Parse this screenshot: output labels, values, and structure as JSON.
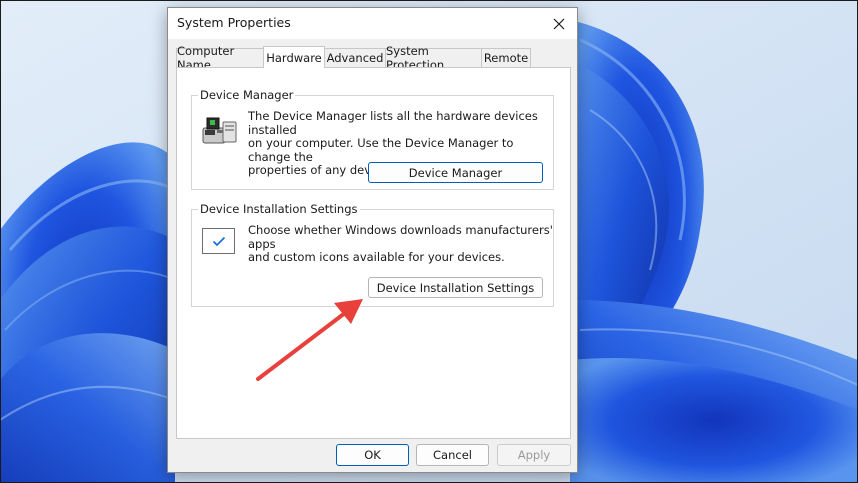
{
  "window": {
    "title": "System Properties"
  },
  "tabs": [
    {
      "label": "Computer Name"
    },
    {
      "label": "Hardware"
    },
    {
      "label": "Advanced"
    },
    {
      "label": "System Protection"
    },
    {
      "label": "Remote"
    }
  ],
  "device_manager": {
    "group_label": "Device Manager",
    "description_line1": "The Device Manager lists all the hardware devices installed",
    "description_line2": "on your computer. Use the Device Manager to change the",
    "description_line3": "properties of any device.",
    "button_label": "Device Manager",
    "icon": "device-manager-icon"
  },
  "device_installation": {
    "group_label": "Device Installation Settings",
    "description_line1": "Choose whether Windows downloads manufacturers' apps",
    "description_line2": "and custom icons available for your devices.",
    "button_label": "Device Installation Settings",
    "icon": "checkbox-check-icon"
  },
  "footer": {
    "ok_label": "OK",
    "cancel_label": "Cancel",
    "apply_label": "Apply"
  },
  "annotation": {
    "arrow_color": "#e8403a"
  },
  "colors": {
    "accent": "#005fb8",
    "wallpaper": "#1f4fd6"
  }
}
